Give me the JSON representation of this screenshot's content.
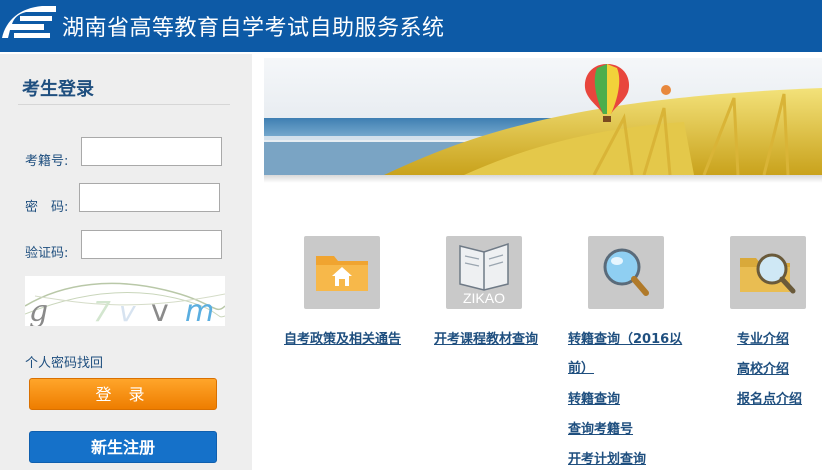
{
  "header": {
    "title": "湖南省高等教育自学考试自助服务系统"
  },
  "login": {
    "title": "考生登录",
    "exam_id_label": "考籍号:",
    "password_label": "密　码:",
    "captcha_label": "验证码:",
    "captcha_chars": [
      "g",
      "7",
      "v",
      "v",
      "m"
    ],
    "forgot_link": "个人密码找回",
    "login_button": "登 录",
    "register_button": "新生注册"
  },
  "services": [
    {
      "icon": "folder-home-icon",
      "links": [
        "自考政策及相关通告"
      ]
    },
    {
      "icon": "zikao-book-icon",
      "icon_text": "ZIKAO",
      "links": [
        "开考课程教材查询"
      ]
    },
    {
      "icon": "magnifier-icon",
      "links": [
        "转籍查询（2016以",
        "前）",
        "转籍查询",
        "查询考籍号",
        "开考计划查询"
      ]
    },
    {
      "icon": "folder-search-icon",
      "links": [
        "专业介绍",
        "高校介绍",
        "报名点介绍"
      ]
    }
  ],
  "colors": {
    "header": "#0d5aa6",
    "accent_text": "#1f4f7f",
    "login_button": "#f28c0e",
    "register_button": "#1571c9"
  }
}
